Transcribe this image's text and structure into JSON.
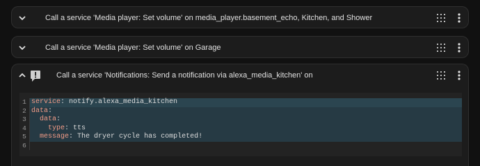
{
  "rows": [
    {
      "title": "Call a service 'Media player: Set volume' on media_player.basement_echo, Kitchen, and Shower",
      "expanded": false,
      "icon": "chevron-down-icon"
    },
    {
      "title": "Call a service 'Media player: Set volume' on Garage",
      "expanded": false,
      "icon": "chevron-down-icon"
    },
    {
      "title": "Call a service 'Notifications: Send a notification via alexa_media_kitchen' on",
      "expanded": true,
      "icon": "chevron-up-icon",
      "status_icon": "alert-icon"
    }
  ],
  "editor": {
    "line_numbers": [
      "1",
      "2",
      "3",
      "4",
      "5",
      "6"
    ],
    "lines": [
      {
        "key": "service",
        "sep": ": ",
        "value": "notify.alexa_media_kitchen",
        "indent": ""
      },
      {
        "key": "data",
        "sep": ":",
        "value": "",
        "indent": ""
      },
      {
        "key": "data",
        "sep": ":",
        "value": "",
        "indent": "  "
      },
      {
        "key": "type",
        "sep": ": ",
        "value": "tts",
        "indent": "    "
      },
      {
        "key": "message",
        "sep": ": ",
        "value": "The dryer cycle has completed!",
        "indent": "  "
      },
      {
        "key": "",
        "sep": "",
        "value": "",
        "indent": ""
      }
    ]
  },
  "colors": {
    "background": "#111111",
    "card": "#1c1c1c",
    "yaml_key": "#f39c87",
    "highlight": "#263a44"
  }
}
